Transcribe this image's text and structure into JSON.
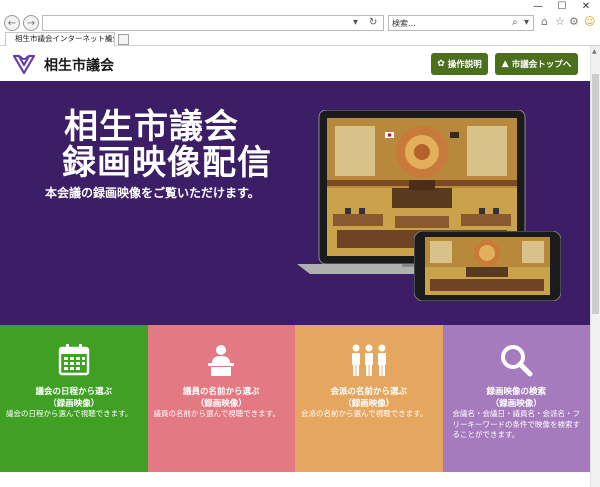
{
  "browser": {
    "address_url": "",
    "search_placeholder": "検索...",
    "tab_title": "相生市議会インターネット議会...",
    "colors": {
      "chrome_bg": "#ffffff",
      "border": "#b8b8b8"
    },
    "icons": [
      "back-icon",
      "forward-icon",
      "search-icon",
      "refresh-icon",
      "home-icon",
      "favorites-star-icon",
      "settings-gear-icon",
      "smiley-icon"
    ]
  },
  "header": {
    "site_title": "相生市議会",
    "buttons": [
      {
        "label": "操作説明",
        "icon": "gear-icon"
      },
      {
        "label": "市議会トップへ",
        "icon": "mountain-icon"
      }
    ],
    "colors": {
      "button_bg": "#4c6f1c",
      "logo": "#6b3fa0"
    }
  },
  "hero": {
    "title_line1": "相生市議会",
    "title_line2": "録画映像配信",
    "subtitle": "本会議の録画映像をご覧いただけます。",
    "colors": {
      "background": "#3b1e66"
    }
  },
  "tiles": [
    {
      "title": "議会の日程から選ぶ",
      "sub": "（録画映像）",
      "desc": "議会の日程から選んで視聴できます。",
      "icon": "calendar-icon",
      "color": "#3fa024"
    },
    {
      "title": "議員の名前から選ぶ",
      "sub": "（録画映像）",
      "desc": "議員の名前から選んで視聴できます。",
      "icon": "speaker-podium-icon",
      "color": "#e37982"
    },
    {
      "title": "会派の名前から選ぶ",
      "sub": "（録画映像）",
      "desc": "会派の名前から選んで視聴できます。",
      "icon": "group-people-icon",
      "color": "#e5a65f"
    },
    {
      "title": "録画映像の検索",
      "sub": "（録画映像）",
      "desc": "会議名・会議日・議員名・会派名・フリーキーワードの条件で映像を検索することができます。",
      "icon": "magnifier-icon",
      "color": "#a57bbd"
    }
  ]
}
